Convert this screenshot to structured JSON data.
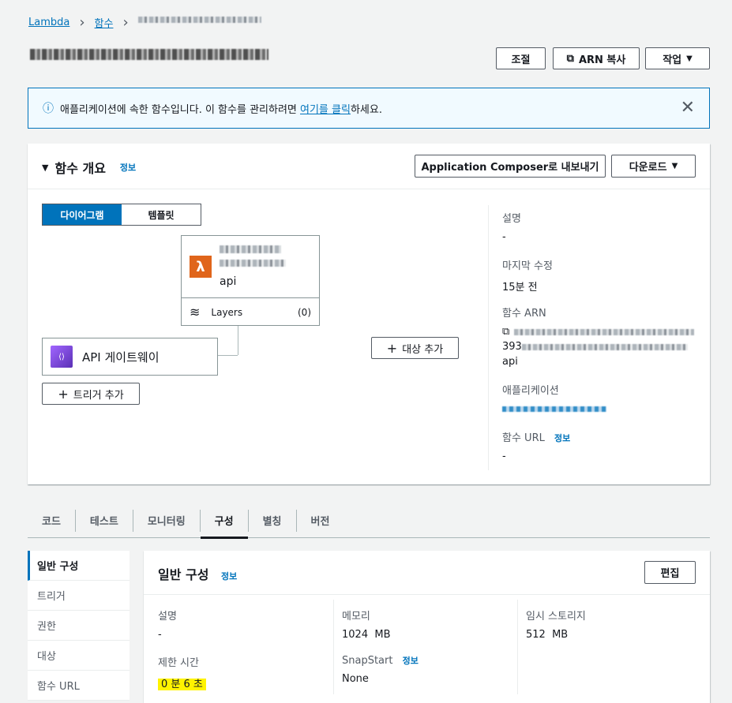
{
  "breadcrumb": {
    "root": "Lambda",
    "functions": "함수"
  },
  "header": {
    "throttle": "조절",
    "copy_arn": "ARN 복사",
    "actions": "작업"
  },
  "banner": {
    "text_before": "애플리케이션에 속한 함수입니다. 이 함수를 관리하려면 ",
    "link": "여기를 클릭",
    "text_after": "하세요."
  },
  "overview": {
    "title": "함수 개요",
    "info": "정보",
    "export_btn": "Application Composer로 내보내기",
    "download_btn": "다운로드",
    "seg_diagram": "다이어그램",
    "seg_template": "템플릿",
    "function_suffix": "api",
    "layers_label": "Layers",
    "layers_count": "(0)",
    "trigger_name": "API 게이트웨이",
    "add_trigger": "트리거 추가",
    "add_destination": "대상 추가",
    "meta": {
      "desc_label": "설명",
      "desc_value": "-",
      "modified_label": "마지막 수정",
      "modified_value": "15분 전",
      "arn_label": "함수 ARN",
      "arn_line2_prefix": "393",
      "arn_line3": "api",
      "app_label": "애플리케이션",
      "url_label": "함수 URL",
      "url_info": "정보",
      "url_value": "-"
    }
  },
  "tabs": [
    "코드",
    "테스트",
    "모니터링",
    "구성",
    "별칭",
    "버전"
  ],
  "active_tab": "구성",
  "nav": [
    "일반 구성",
    "트리거",
    "권한",
    "대상",
    "함수 URL"
  ],
  "config": {
    "title": "일반 구성",
    "info": "정보",
    "edit": "편집",
    "desc_label": "설명",
    "desc_value": "-",
    "memory_label": "메모리",
    "memory_value": "1024  MB",
    "storage_label": "임시 스토리지",
    "storage_value": "512  MB",
    "timeout_label": "제한 시간",
    "timeout_value": "0 분 6 초",
    "snapstart_label": "SnapStart",
    "snapstart_info": "정보",
    "snapstart_value": "None"
  },
  "colors": {
    "accent": "#0073bb",
    "lambda": "#e0651b",
    "highlight": "#fff300"
  }
}
